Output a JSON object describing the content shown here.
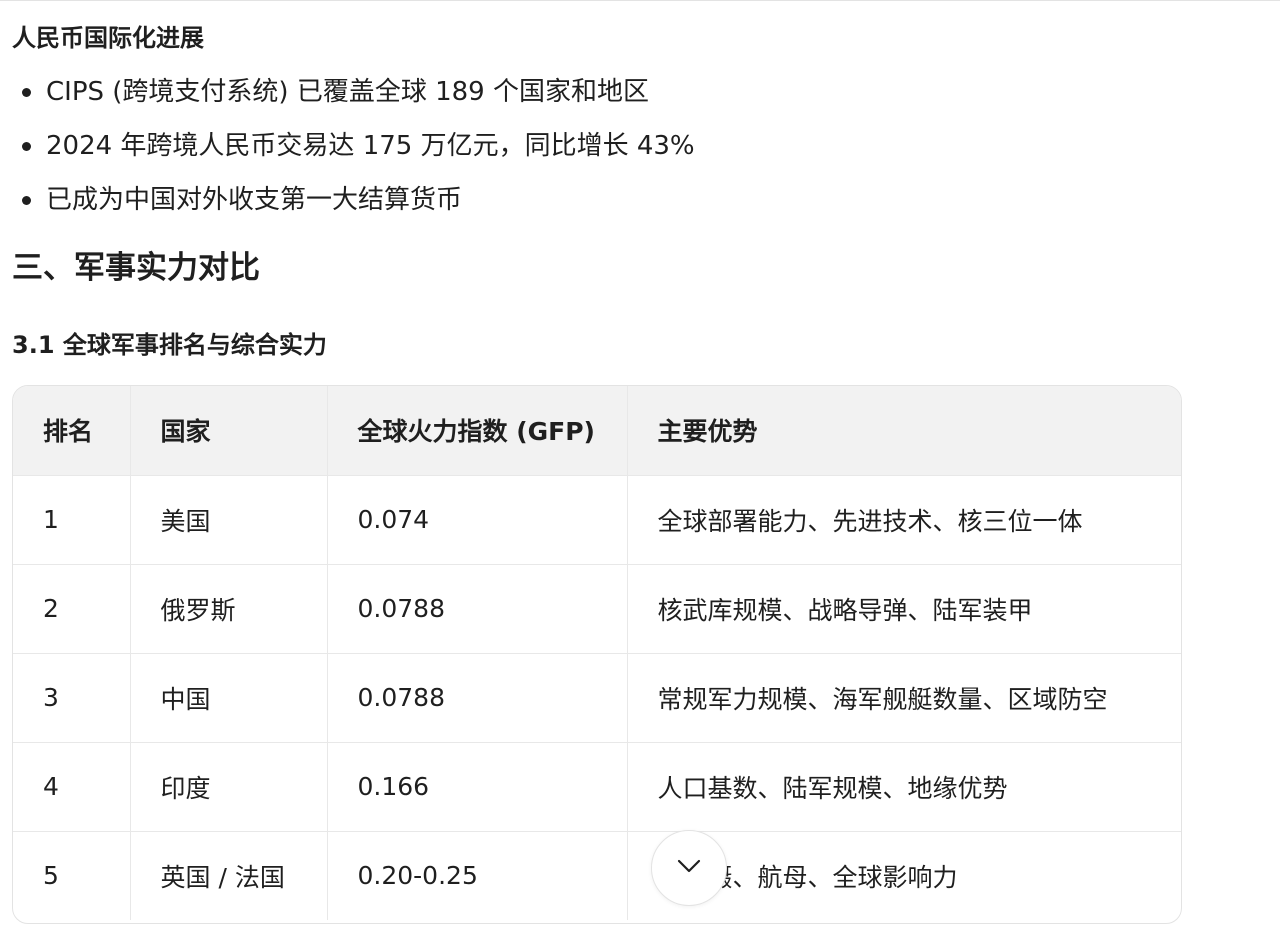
{
  "rmb_section": {
    "title": "人民币国际化进展",
    "bullets": [
      "CIPS (跨境支付系统) 已覆盖全球 189 个国家和地区",
      "2024 年跨境人民币交易达 175 万亿元，同比增长 43%",
      "已成为中国对外收支第一大结算货币"
    ]
  },
  "military": {
    "heading": "三、军事实力对比",
    "subheading": "3.1 全球军事排名与综合实力",
    "table": {
      "headers": [
        "排名",
        "国家",
        "全球火力指数 (GFP)",
        "主要优势"
      ],
      "rows": [
        [
          "1",
          "美国",
          "0.074",
          "全球部署能力、先进技术、核三位一体"
        ],
        [
          "2",
          "俄罗斯",
          "0.0788",
          "核武库规模、战略导弹、陆军装甲"
        ],
        [
          "3",
          "中国",
          "0.0788",
          "常规军力规模、海军舰艇数量、区域防空"
        ],
        [
          "4",
          "印度",
          "0.166",
          "人口基数、陆军规模、地缘优势"
        ],
        [
          "5",
          "英国 / 法国",
          "0.20-0.25",
          "核威慑、航母、全球影响力"
        ]
      ]
    }
  },
  "scroll_button": {
    "icon": "chevron-down-icon"
  }
}
